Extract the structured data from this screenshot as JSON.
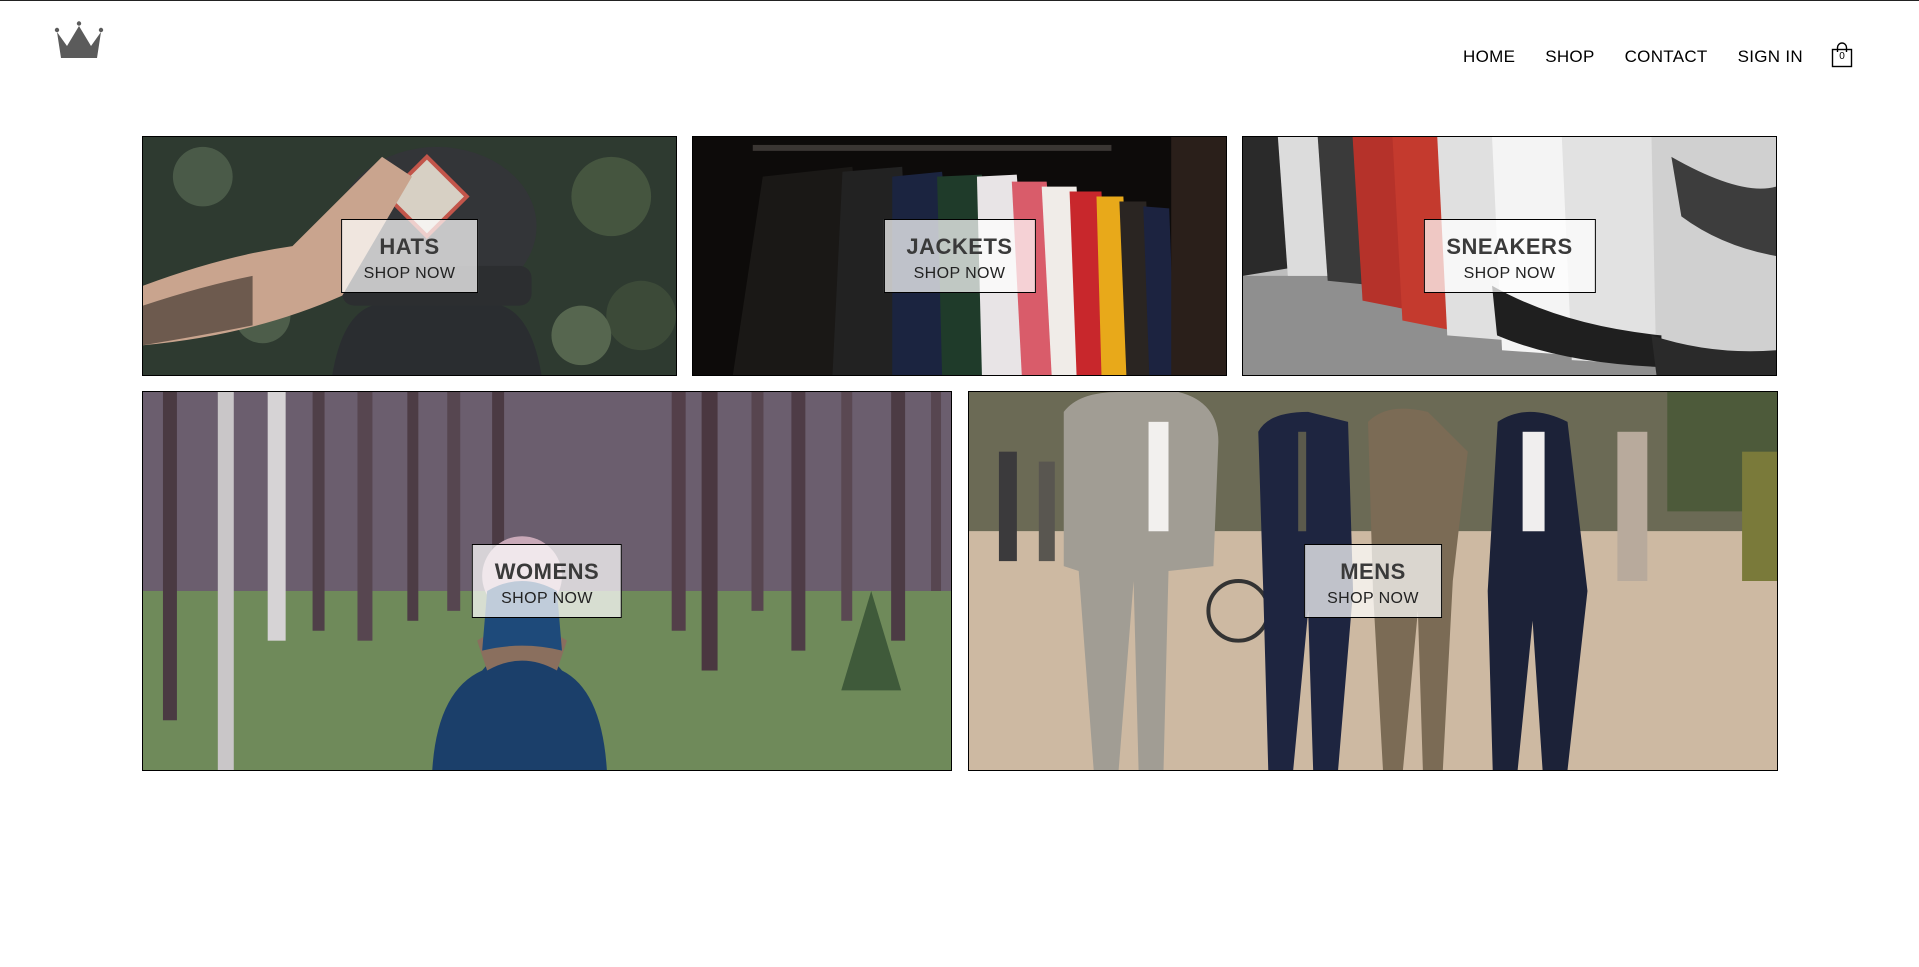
{
  "header": {
    "logo_icon": "crown-icon",
    "nav": [
      {
        "label": "HOME"
      },
      {
        "label": "SHOP"
      },
      {
        "label": "CONTACT"
      },
      {
        "label": "SIGN IN"
      }
    ],
    "cart": {
      "icon": "shopping-bag-icon",
      "count": "0"
    }
  },
  "directory": {
    "sections": [
      {
        "title": "HATS",
        "subtitle": "SHOP NOW",
        "image": "person-with-baseball-cap"
      },
      {
        "title": "JACKETS",
        "subtitle": "SHOP NOW",
        "image": "clothes-on-rack"
      },
      {
        "title": "SNEAKERS",
        "subtitle": "SHOP NOW",
        "image": "sneakers-on-shelf"
      },
      {
        "title": "WOMENS",
        "subtitle": "SHOP NOW",
        "image": "woman-in-forest"
      },
      {
        "title": "MENS",
        "subtitle": "SHOP NOW",
        "image": "men-in-suits-walking"
      }
    ]
  },
  "colors": {
    "background": "#ffffff",
    "text": "#000000",
    "title_text": "#3a3a3a",
    "logo": "#555555",
    "tile_border": "#000000"
  }
}
